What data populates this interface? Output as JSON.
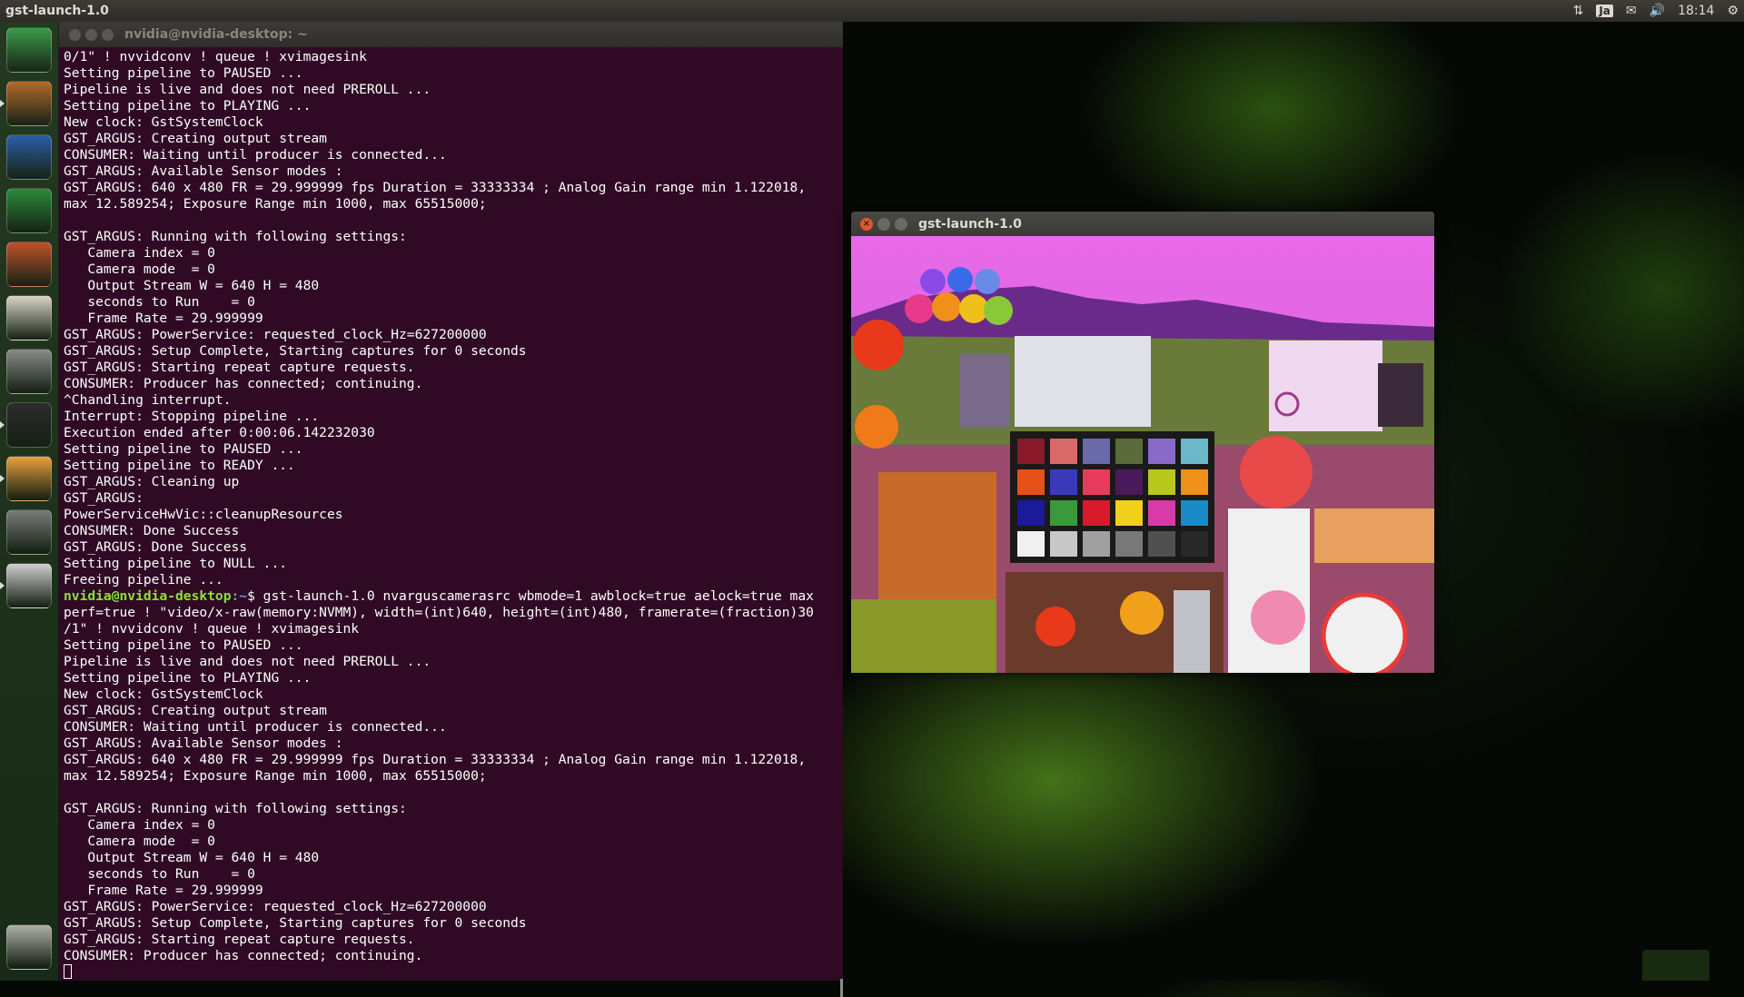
{
  "top_panel": {
    "app_title": "gst-launch-1.0",
    "keyboard_layout": "Ja",
    "clock": "18:14"
  },
  "launcher": {
    "items": [
      {
        "name": "system-updater-icon",
        "color": "#3b9a4a"
      },
      {
        "name": "files-icon",
        "color": "#b46a2a"
      },
      {
        "name": "writer-icon",
        "color": "#2a5fa8"
      },
      {
        "name": "calc-icon",
        "color": "#2a8a3a"
      },
      {
        "name": "impress-icon",
        "color": "#c0532a"
      },
      {
        "name": "software-center-icon",
        "color": "#d9d4c8"
      },
      {
        "name": "system-settings-icon",
        "color": "#8a8a8a"
      },
      {
        "name": "terminal-icon",
        "color": "#2c2c2c"
      },
      {
        "name": "text-editor-icon",
        "color": "#e8a040"
      },
      {
        "name": "help-icon",
        "color": "#7a7a7a"
      },
      {
        "name": "drive-icon",
        "color": "#d0d0d0"
      }
    ],
    "trash": {
      "name": "trash-icon",
      "color": "#b0b0a8"
    }
  },
  "terminal": {
    "title": "nvidia@nvidia-desktop: ~",
    "lines_before": [
      "0/1\" ! nvvidconv ! queue ! xvimagesink",
      "Setting pipeline to PAUSED ...",
      "Pipeline is live and does not need PREROLL ...",
      "Setting pipeline to PLAYING ...",
      "New clock: GstSystemClock",
      "GST_ARGUS: Creating output stream",
      "CONSUMER: Waiting until producer is connected...",
      "GST_ARGUS: Available Sensor modes :",
      "GST_ARGUS: 640 x 480 FR = 29.999999 fps Duration = 33333334 ; Analog Gain range min 1.122018,",
      "max 12.589254; Exposure Range min 1000, max 65515000;",
      "",
      "GST_ARGUS: Running with following settings:",
      "   Camera index = 0",
      "   Camera mode  = 0",
      "   Output Stream W = 640 H = 480",
      "   seconds to Run    = 0",
      "   Frame Rate = 29.999999",
      "GST_ARGUS: PowerService: requested_clock_Hz=627200000",
      "GST_ARGUS: Setup Complete, Starting captures for 0 seconds",
      "GST_ARGUS: Starting repeat capture requests.",
      "CONSUMER: Producer has connected; continuing.",
      "^Chandling interrupt.",
      "Interrupt: Stopping pipeline ...",
      "Execution ended after 0:00:06.142232030",
      "Setting pipeline to PAUSED ...",
      "Setting pipeline to READY ...",
      "GST_ARGUS: Cleaning up",
      "GST_ARGUS:",
      "PowerServiceHwVic::cleanupResources",
      "CONSUMER: Done Success",
      "GST_ARGUS: Done Success",
      "Setting pipeline to NULL ...",
      "Freeing pipeline ..."
    ],
    "prompt_user": "nvidia@nvidia-desktop",
    "prompt_path": ":~",
    "prompt_symbol": "$ ",
    "command_line1": "gst-launch-1.0 nvarguscamerasrc wbmode=1 awblock=true aelock=true max",
    "command_lines": [
      "perf=true ! \"video/x-raw(memory:NVMM), width=(int)640, height=(int)480, framerate=(fraction)30",
      "/1\" ! nvvidconv ! queue ! xvimagesink"
    ],
    "lines_after": [
      "Setting pipeline to PAUSED ...",
      "Pipeline is live and does not need PREROLL ...",
      "Setting pipeline to PLAYING ...",
      "New clock: GstSystemClock",
      "GST_ARGUS: Creating output stream",
      "CONSUMER: Waiting until producer is connected...",
      "GST_ARGUS: Available Sensor modes :",
      "GST_ARGUS: 640 x 480 FR = 29.999999 fps Duration = 33333334 ; Analog Gain range min 1.122018,",
      "max 12.589254; Exposure Range min 1000, max 65515000;",
      "",
      "GST_ARGUS: Running with following settings:",
      "   Camera index = 0",
      "   Camera mode  = 0",
      "   Output Stream W = 640 H = 480",
      "   seconds to Run    = 0",
      "   Frame Rate = 29.999999",
      "GST_ARGUS: PowerService: requested_clock_Hz=627200000",
      "GST_ARGUS: Setup Complete, Starting captures for 0 seconds",
      "GST_ARGUS: Starting repeat capture requests.",
      "CONSUMER: Producer has connected; continuing."
    ]
  },
  "camera_window": {
    "title": "gst-launch-1.0",
    "checker_colors": [
      "#8a1a2a",
      "#d86a6a",
      "#6a6aa8",
      "#5a6a3a",
      "#8a6ac8",
      "#6ab8c8",
      "#e8501a",
      "#3a3ab8",
      "#e83a5a",
      "#4a1a5a",
      "#b8c81a",
      "#f0901a",
      "#1a1a9a",
      "#3a9a3a",
      "#d81a2a",
      "#f0d01a",
      "#d83aa8",
      "#1a8ac8",
      "#f0f0f0",
      "#c8c8c8",
      "#a0a0a0",
      "#787878",
      "#505050",
      "#282828"
    ]
  }
}
